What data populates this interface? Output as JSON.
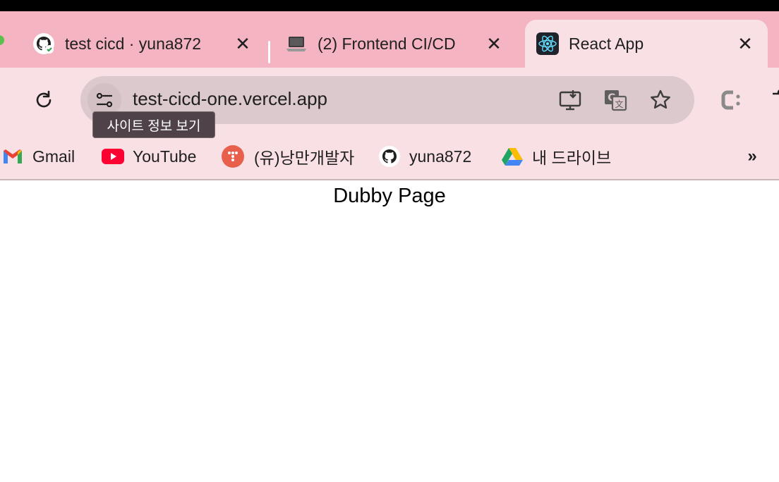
{
  "tabs": [
    {
      "title": "test cicd · yuna872",
      "icon": "github-icon",
      "active": false
    },
    {
      "title": "(2) Frontend CI/CD",
      "icon": "laptop-icon",
      "active": false
    },
    {
      "title": "React App",
      "icon": "react-icon",
      "active": true
    }
  ],
  "toolbar": {
    "url": "test-cicd-one.vercel.app",
    "site_info_tooltip": "사이트 정보 보기"
  },
  "bookmarks": [
    {
      "label": "Gmail",
      "icon": "gmail-icon"
    },
    {
      "label": "YouTube",
      "icon": "youtube-icon"
    },
    {
      "label": "(유)낭만개발자",
      "icon": "dots-logo-icon"
    },
    {
      "label": "yuna872",
      "icon": "github-icon"
    },
    {
      "label": "내 드라이브",
      "icon": "google-drive-icon"
    }
  ],
  "page": {
    "heading": "Dubby Page"
  },
  "colors": {
    "tabstrip": "#f4b4c1",
    "toolbar": "#f9e0e5",
    "omnibox": "#dcc9cd",
    "tooltip": "#4f4248"
  }
}
